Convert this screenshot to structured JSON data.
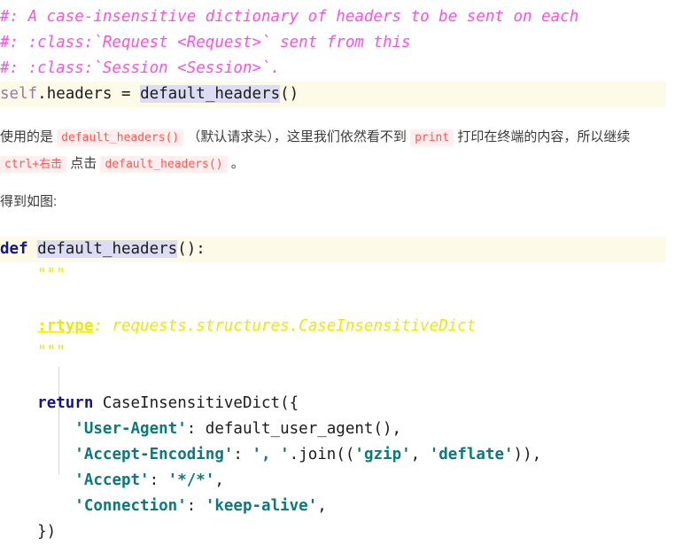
{
  "page": {
    "type": "markdown-article",
    "language": "zh-CN"
  },
  "colors": {
    "background": "#ffffff",
    "code_line_highlight": "#fdfbe7",
    "symbol_selection": "#dcdcf4",
    "comment": "#ff4fe0",
    "keyword": "#14148c",
    "self_keyword": "#9a76a8",
    "docstring": "#eaea00",
    "string": "#0b7a7a",
    "inline_code_text": "#ff5555",
    "inline_code_bg": "#ffeeee",
    "indent_guide": "#d8d8d8",
    "body_text": "#3a3a3a"
  },
  "top_code_block": {
    "language": "python",
    "lines": [
      {
        "id": "line-1",
        "highlighted": false,
        "tokens": [
          {
            "kind": "comment",
            "text": "#: A case-insensitive dictionary of headers to be sent on each"
          }
        ]
      },
      {
        "id": "line-2",
        "highlighted": false,
        "tokens": [
          {
            "kind": "comment",
            "text": "#: :class:`Request <Request>` sent from this"
          }
        ]
      },
      {
        "id": "line-3",
        "highlighted": false,
        "tokens": [
          {
            "kind": "comment",
            "text": "#: :class:`Session <Session>`."
          }
        ]
      },
      {
        "id": "line-4",
        "highlighted": true,
        "tokens": [
          {
            "kind": "self",
            "text": "self"
          },
          {
            "kind": "plain",
            "text": ".headers = "
          },
          {
            "kind": "symbol-selected",
            "text": "default_headers"
          },
          {
            "kind": "plain",
            "text": "()"
          }
        ]
      }
    ]
  },
  "paragraphs": {
    "p1": {
      "segments": [
        {
          "kind": "text",
          "text": "使用的是 "
        },
        {
          "kind": "code",
          "text": "default_headers()"
        },
        {
          "kind": "text",
          "text": " （默认请求头），这里我们依然看不到 "
        },
        {
          "kind": "code",
          "text": "print"
        },
        {
          "kind": "text",
          "text": " 打印在终端的内容，所以继续 "
        },
        {
          "kind": "code",
          "text": "ctrl+右击"
        },
        {
          "kind": "text",
          "text": " 点击 "
        },
        {
          "kind": "code",
          "text": "default_headers()"
        },
        {
          "kind": "text",
          "text": " 。"
        }
      ]
    },
    "p2": {
      "segments": [
        {
          "kind": "text",
          "text": "得到如图:"
        }
      ]
    }
  },
  "bottom_code_block": {
    "language": "python",
    "indent_guide": true,
    "lines": [
      {
        "id": "line-1",
        "highlighted": true,
        "tokens": [
          {
            "kind": "keyword",
            "text": "def"
          },
          {
            "kind": "plain",
            "text": " "
          },
          {
            "kind": "symbol-selected",
            "text": "default_headers"
          },
          {
            "kind": "plain",
            "text": "():"
          }
        ]
      },
      {
        "id": "line-2",
        "highlighted": false,
        "tokens": [
          {
            "kind": "docstring-quote",
            "text": "    \"\"\""
          }
        ]
      },
      {
        "id": "line-3",
        "highlighted": false,
        "tokens": [
          {
            "kind": "plain",
            "text": ""
          }
        ]
      },
      {
        "id": "line-4",
        "highlighted": false,
        "tokens": [
          {
            "kind": "plain",
            "text": "    "
          },
          {
            "kind": "rtype",
            "text": ":rtype"
          },
          {
            "kind": "docstring",
            "text": ": requests.structures.CaseInsensitiveDict"
          }
        ]
      },
      {
        "id": "line-5",
        "highlighted": false,
        "tokens": [
          {
            "kind": "docstring-quote",
            "text": "    \"\"\""
          }
        ]
      },
      {
        "id": "line-6",
        "highlighted": false,
        "tokens": [
          {
            "kind": "plain",
            "text": ""
          }
        ]
      },
      {
        "id": "line-7",
        "highlighted": false,
        "tokens": [
          {
            "kind": "plain",
            "text": "    "
          },
          {
            "kind": "keyword",
            "text": "return"
          },
          {
            "kind": "plain",
            "text": " CaseInsensitiveDict({"
          }
        ]
      },
      {
        "id": "line-8",
        "highlighted": false,
        "tokens": [
          {
            "kind": "plain",
            "text": "        "
          },
          {
            "kind": "string",
            "text": "'User-Agent'"
          },
          {
            "kind": "plain",
            "text": ": default_user_agent(),"
          }
        ]
      },
      {
        "id": "line-9",
        "highlighted": false,
        "tokens": [
          {
            "kind": "plain",
            "text": "        "
          },
          {
            "kind": "string",
            "text": "'Accept-Encoding'"
          },
          {
            "kind": "plain",
            "text": ": "
          },
          {
            "kind": "string",
            "text": "', '"
          },
          {
            "kind": "plain",
            "text": ".join(("
          },
          {
            "kind": "string",
            "text": "'gzip'"
          },
          {
            "kind": "plain",
            "text": ", "
          },
          {
            "kind": "string",
            "text": "'deflate'"
          },
          {
            "kind": "plain",
            "text": ")),"
          }
        ]
      },
      {
        "id": "line-10",
        "highlighted": false,
        "tokens": [
          {
            "kind": "plain",
            "text": "        "
          },
          {
            "kind": "string",
            "text": "'Accept'"
          },
          {
            "kind": "plain",
            "text": ": "
          },
          {
            "kind": "string",
            "text": "'*/*'"
          },
          {
            "kind": "plain",
            "text": ","
          }
        ]
      },
      {
        "id": "line-11",
        "highlighted": false,
        "tokens": [
          {
            "kind": "plain",
            "text": "        "
          },
          {
            "kind": "string",
            "text": "'Connection'"
          },
          {
            "kind": "plain",
            "text": ": "
          },
          {
            "kind": "string",
            "text": "'keep-alive'"
          },
          {
            "kind": "plain",
            "text": ","
          }
        ]
      },
      {
        "id": "line-12",
        "highlighted": false,
        "tokens": [
          {
            "kind": "plain",
            "text": "    })"
          }
        ]
      }
    ]
  }
}
